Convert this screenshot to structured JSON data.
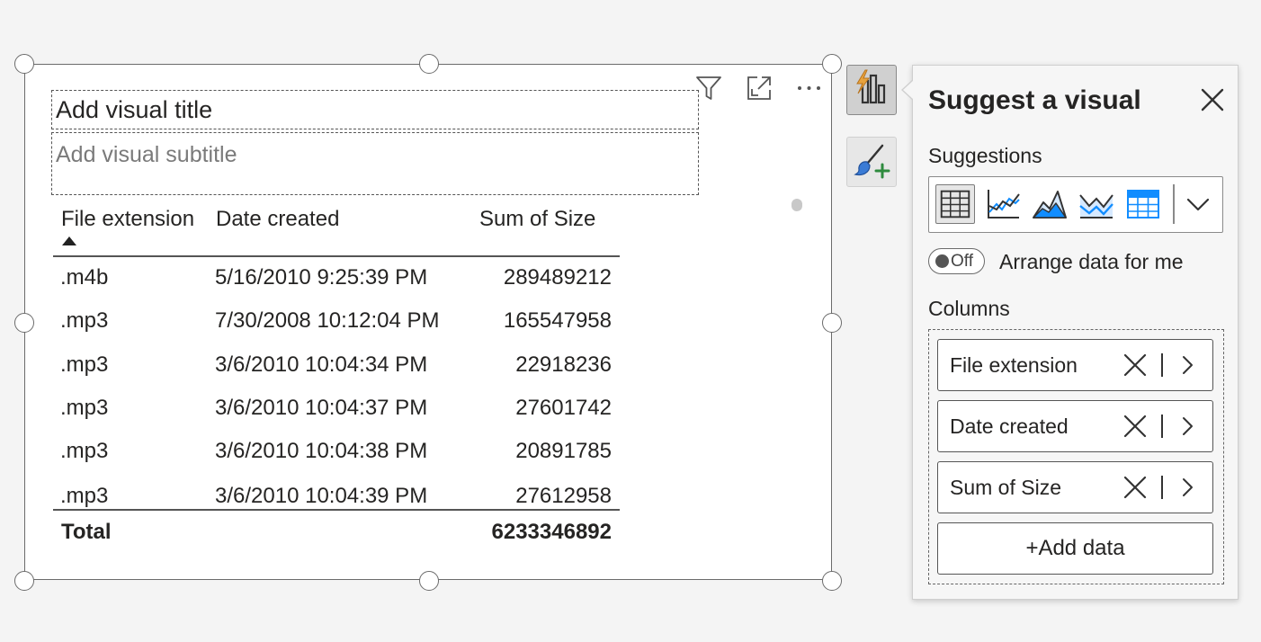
{
  "visual": {
    "title_placeholder": "Add visual title",
    "subtitle_placeholder": "Add visual subtitle",
    "header_icons": [
      "filter-icon",
      "focus-mode-icon",
      "more-options-icon"
    ]
  },
  "table": {
    "columns": [
      "File extension",
      "Date created",
      "Sum of Size"
    ],
    "sorted_column": "File extension",
    "sort_direction": "ascending",
    "rows": [
      [
        ".m4b",
        "5/16/2010 9:25:39 PM",
        "289489212"
      ],
      [
        ".mp3",
        "7/30/2008 10:12:04 PM",
        "165547958"
      ],
      [
        ".mp3",
        "3/6/2010 10:04:34 PM",
        "22918236"
      ],
      [
        ".mp3",
        "3/6/2010 10:04:37 PM",
        "27601742"
      ],
      [
        ".mp3",
        "3/6/2010 10:04:38 PM",
        "20891785"
      ],
      [
        ".mp3",
        "3/6/2010 10:04:39 PM",
        "27612958"
      ]
    ],
    "total_label": "Total",
    "total_value": "6233346892"
  },
  "side_buttons": [
    "suggest-visual-icon",
    "format-visual-icon"
  ],
  "panel": {
    "title": "Suggest a visual",
    "suggestions_label": "Suggestions",
    "suggestion_icons": [
      "table-icon",
      "line-chart-icon",
      "area-chart-icon",
      "stacked-area-chart-icon",
      "matrix-icon",
      "chevron-down-icon"
    ],
    "toggle_state": "Off",
    "arrange_label": "Arrange data for me",
    "columns_label": "Columns",
    "columns": [
      "File extension",
      "Date created",
      "Sum of Size"
    ],
    "add_data_label": "+Add data"
  },
  "colors": {
    "accent_blue": "#118dff",
    "lightning_orange": "#e8a33d",
    "brush_blue": "#3a7bd5",
    "plus_green": "#2e8b3e"
  }
}
